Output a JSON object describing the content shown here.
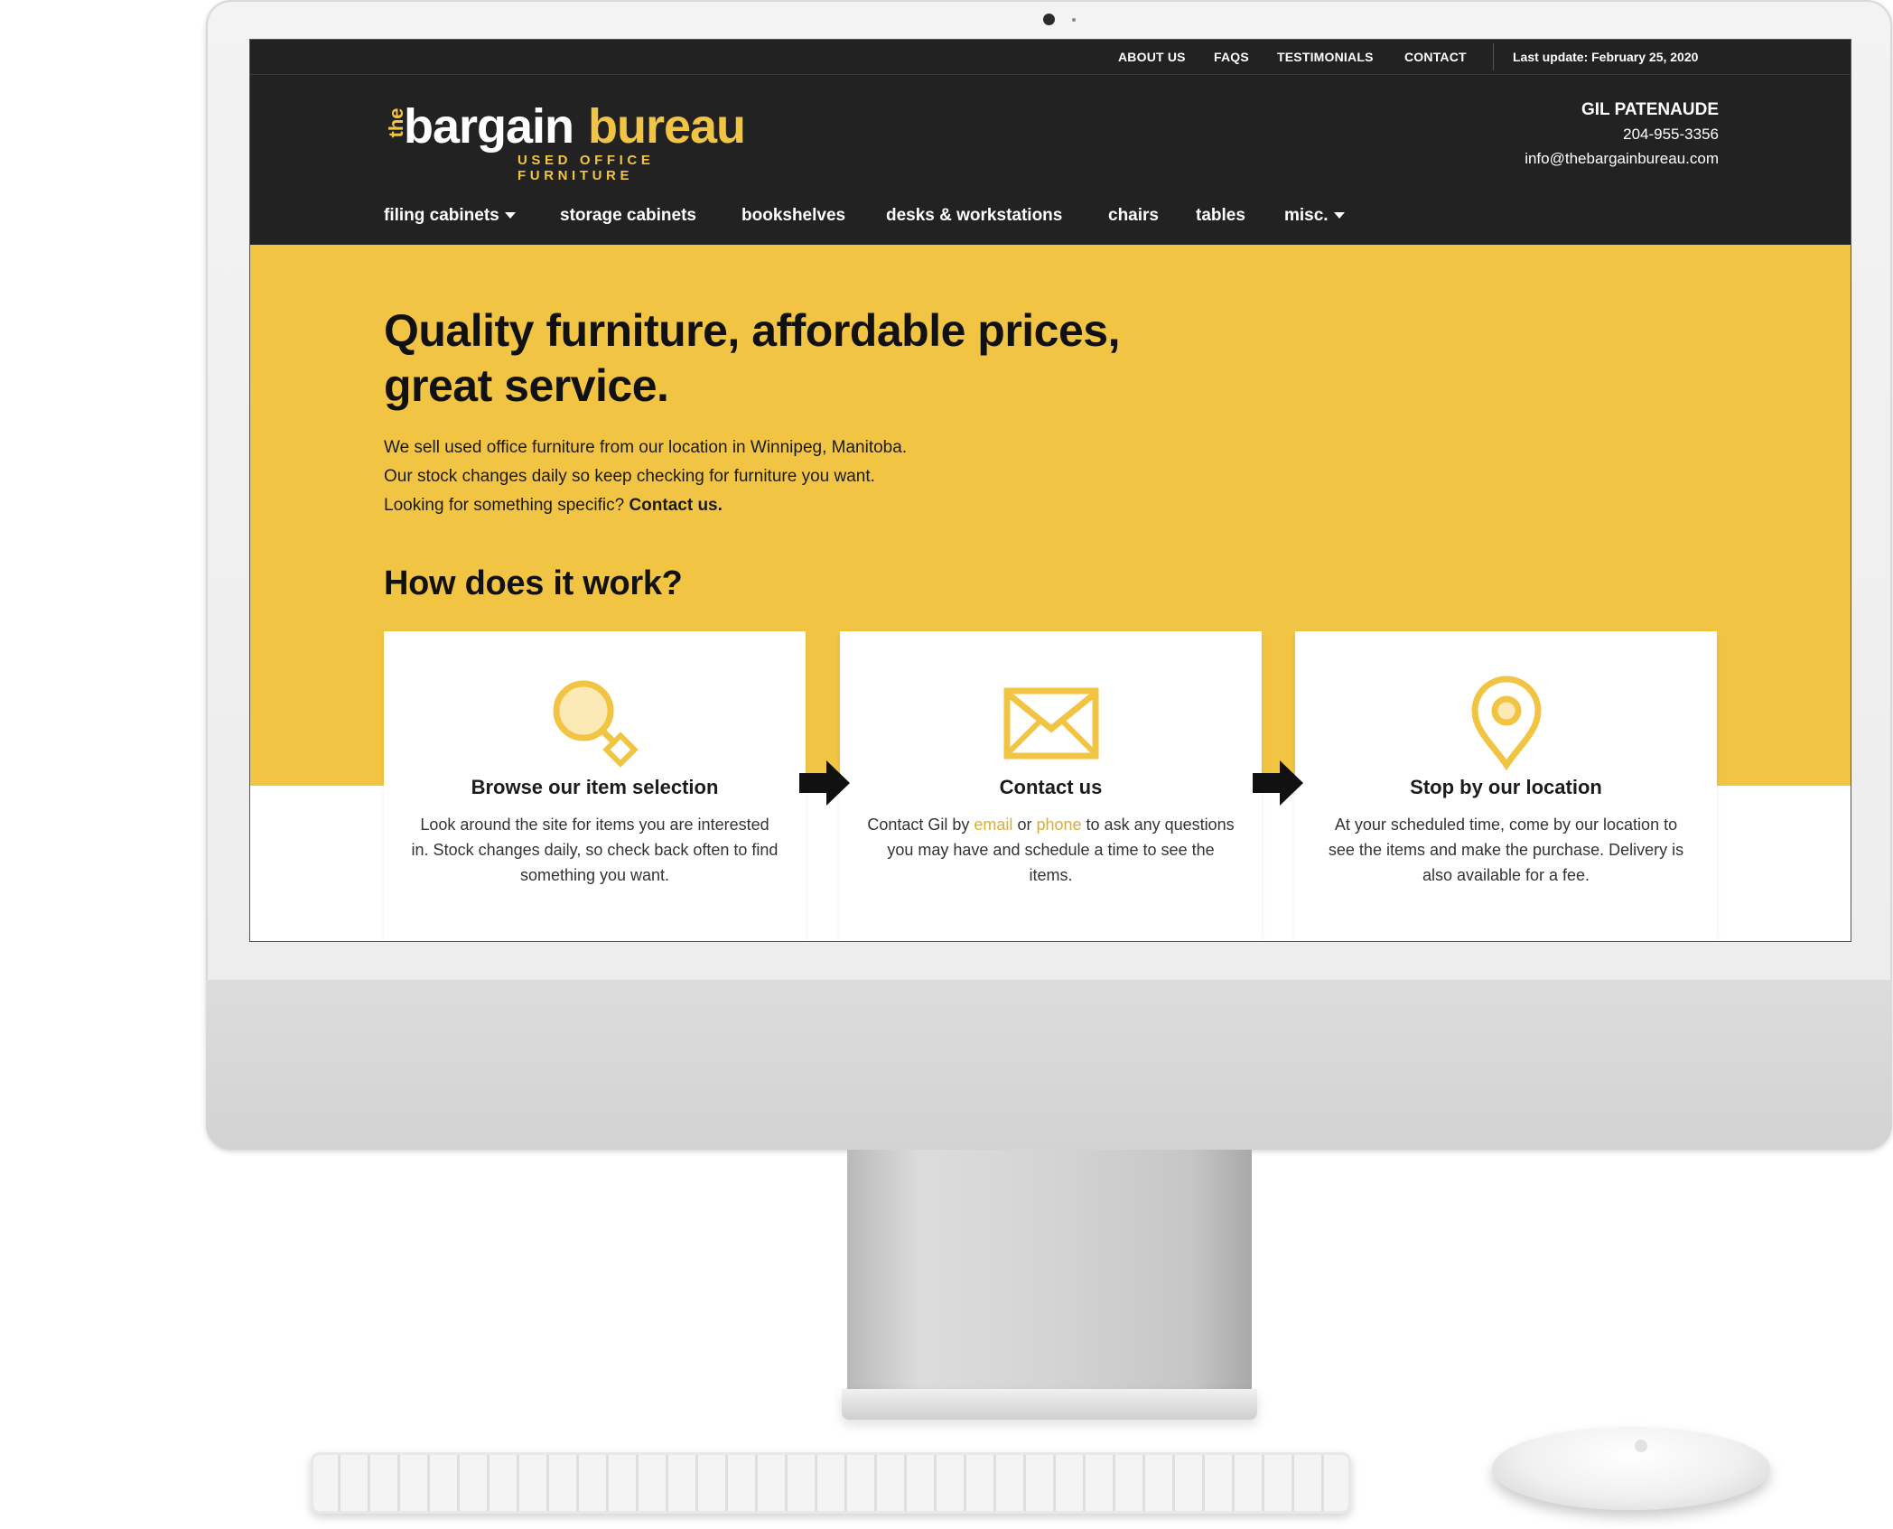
{
  "topbar": {
    "links": [
      "ABOUT US",
      "FAQS",
      "TESTIMONIALS",
      "CONTACT"
    ],
    "last_update": "Last update: February 25, 2020"
  },
  "logo": {
    "the": "the",
    "bargain": "bargain",
    "bureau": "bureau",
    "tagline": "USED OFFICE FURNITURE"
  },
  "contact": {
    "name": "GIL PATENAUDE",
    "phone": "204-955-3356",
    "email": "info@thebargainbureau.com"
  },
  "nav": {
    "items": [
      "filing cabinets",
      "storage cabinets",
      "bookshelves",
      "desks & workstations",
      "chairs",
      "tables",
      "misc."
    ]
  },
  "hero": {
    "title": "Quality furniture, affordable prices, great service.",
    "line1": "We sell used office furniture from our location in Winnipeg, Manitoba.",
    "line2": "Our stock changes daily so keep checking for furniture you want.",
    "line3": "Looking for something specific?",
    "contact_link": "Contact us."
  },
  "how": {
    "title": "How does it work?",
    "steps": [
      {
        "icon": "magnifier-icon",
        "title": "Browse our item selection",
        "text": "Look around the site for items you are interested in. Stock changes daily, so check back often to find something you want."
      },
      {
        "icon": "envelope-icon",
        "title": "Contact us",
        "text_a": "Contact Gil by",
        "link_email": "email",
        "text_b": "or",
        "link_phone": "phone",
        "text_c": "to ask any questions you may have and schedule a time to see the items."
      },
      {
        "icon": "map-pin-icon",
        "title": "Stop by our location",
        "text": "At your scheduled time, come by our location to see the items and make the purchase. Delivery is also available for a fee."
      }
    ]
  },
  "colors": {
    "accent": "#f2c443",
    "dark": "#222222",
    "link": "#e0ad26"
  }
}
